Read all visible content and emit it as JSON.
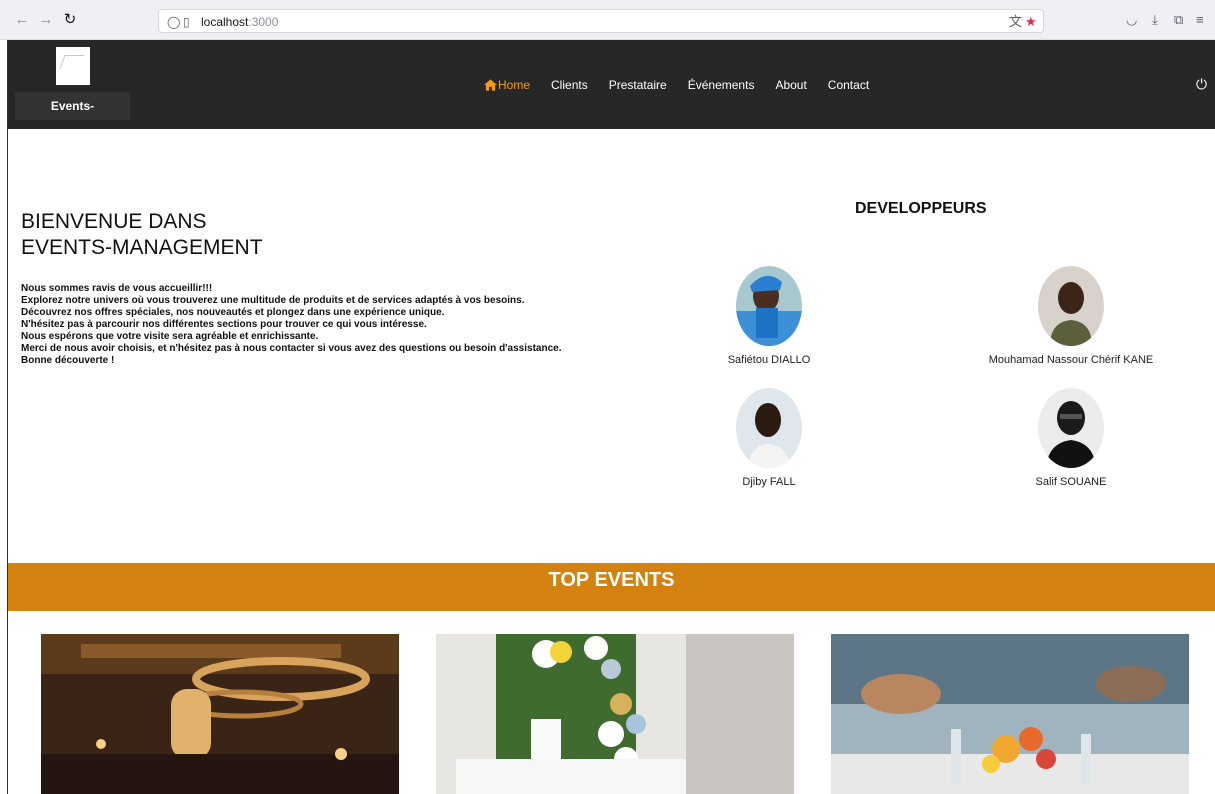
{
  "browser": {
    "url_host": "localhost",
    "url_port": ":3000"
  },
  "header": {
    "brand": "Events-Management",
    "nav": [
      {
        "label": "Home",
        "active": true
      },
      {
        "label": "Clients"
      },
      {
        "label": "Prestataire"
      },
      {
        "label": "Événements"
      },
      {
        "label": "About"
      },
      {
        "label": "Contact"
      }
    ],
    "accent_color": "#f39c12",
    "icons": {
      "home": "home-icon",
      "power": "power-icon"
    }
  },
  "welcome": {
    "title_line1": "BIENVENUE DANS",
    "title_line2": "EVENTS-MANAGEMENT",
    "paragraphs": [
      "Nous sommes ravis de vous accueillir!!!",
      "Explorez notre univers où vous trouverez une multitude de produits et de services adaptés à vos besoins.",
      "Découvrez nos offres spéciales, nos nouveautés et plongez dans une expérience unique.",
      "N'hésitez pas à parcourir nos différentes sections pour trouver ce qui vous intéresse.",
      "Nous espérons que votre visite sera agréable et enrichissante.",
      "Merci de nous avoir choisis, et n'hésitez pas à nous contacter si vous avez des questions ou besoin d'assistance.",
      "Bonne découverte !"
    ]
  },
  "developers": {
    "title": "DEVELOPPEURS",
    "people": [
      {
        "name": "Safiétou DIALLO"
      },
      {
        "name": "Mouhamad Nassour Chérif KANE"
      },
      {
        "name": "Djiby FALL"
      },
      {
        "name": "Salif SOUANE"
      }
    ]
  },
  "top_events": {
    "title": "TOP EVENTS",
    "bar_color": "#d4820f"
  }
}
